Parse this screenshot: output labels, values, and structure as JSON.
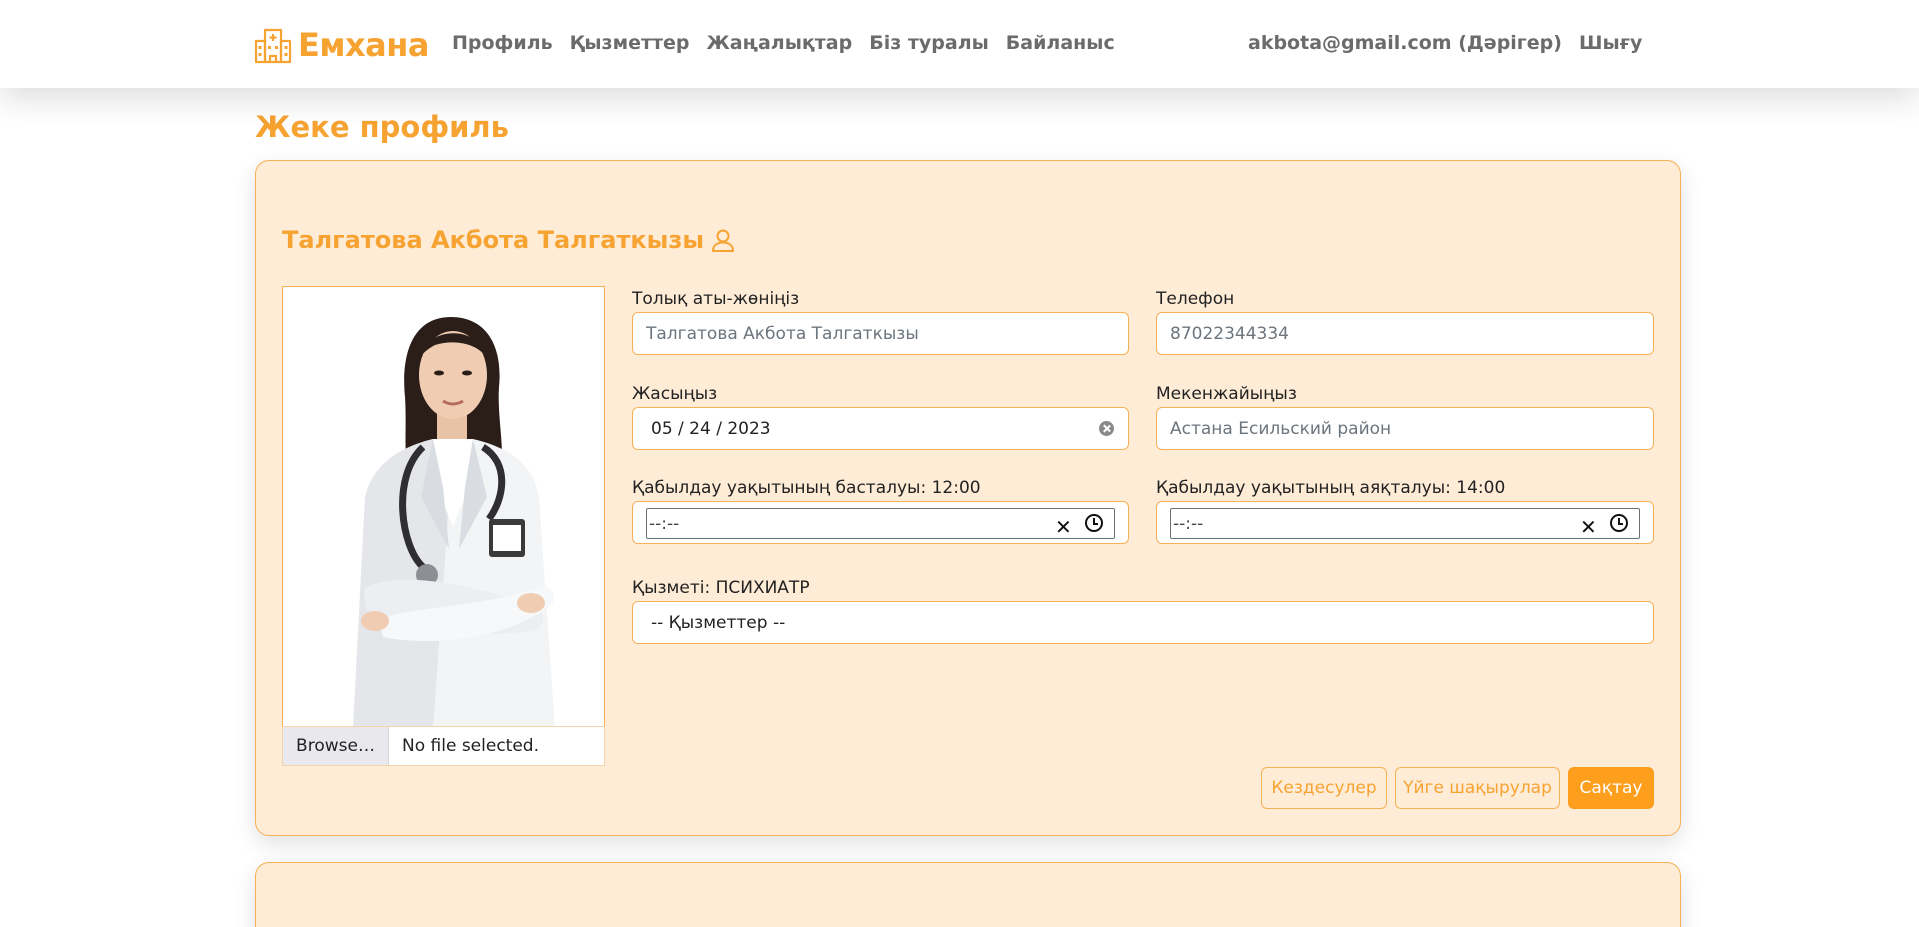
{
  "navbar": {
    "brand": "Емхана",
    "links": [
      "Профиль",
      "Қызметтер",
      "Жаңалықтар",
      "Біз туралы",
      "Байланыс"
    ],
    "user": "akbota@gmail.com (Дәрігер)",
    "logout": "Шығу"
  },
  "page": {
    "title": "Жеке профиль"
  },
  "profile": {
    "name": "Талгатова Акбота Талгаткызы",
    "file_button": "Browse…",
    "file_status": "No file selected."
  },
  "form": {
    "full_name_label": "Толық аты-жөніңіз",
    "full_name_placeholder": "Талгатова Акбота Талгаткызы",
    "phone_label": "Телефон",
    "phone_placeholder": "87022344334",
    "age_label": "Жасыңыз",
    "age_value": "05 / 24 / 2023",
    "address_label": "Мекенжайыңыз",
    "address_placeholder": "Астана Есильский район",
    "start_label": "Қабылдау уақытының басталуы: 12:00",
    "start_value": "--:--",
    "end_label": "Қабылдау уақытының аяқталуы: 14:00",
    "end_value": "--:--",
    "service_label": "Қызметі: ПСИХИАТР",
    "service_selected": "-- Қызметтер --"
  },
  "buttons": {
    "meetings": "Кездесулер",
    "home_calls": "Үйге шақырулар",
    "save": "Сақтау"
  },
  "colors": {
    "accent": "#f7a332",
    "card_bg": "#feecd7",
    "primary_button": "#fd9e1c"
  }
}
